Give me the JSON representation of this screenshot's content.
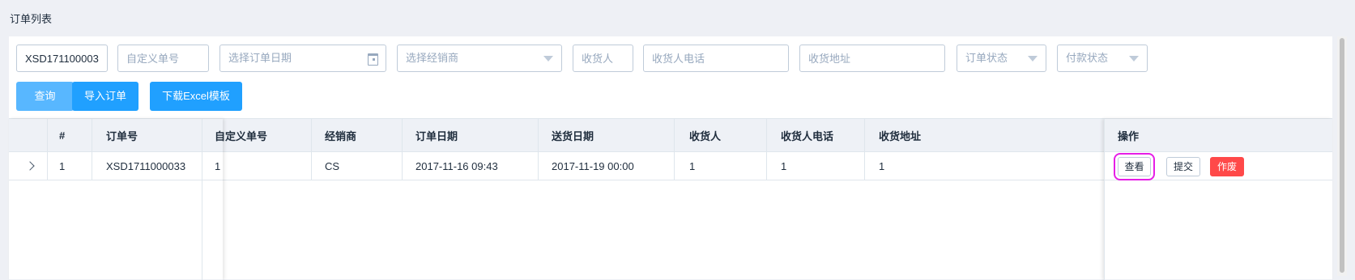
{
  "page": {
    "title": "订单列表"
  },
  "filters": {
    "order_no_value": "XSD171100003",
    "custom_no_placeholder": "自定义单号",
    "date_placeholder": "选择订单日期",
    "dealer_placeholder": "选择经销商",
    "receiver_placeholder": "收货人",
    "receiver_phone_placeholder": "收货人电话",
    "address_placeholder": "收货地址",
    "order_status_placeholder": "订单状态",
    "payment_status_placeholder": "付款状态"
  },
  "actions": {
    "query_label": "查询",
    "import_label": "导入订单",
    "download_label": "下载Excel模板"
  },
  "table": {
    "headers": [
      "",
      "#",
      "订单号",
      "自定义单号",
      "经销商",
      "订单日期",
      "送货日期",
      "收货人",
      "收货人电话",
      "收货地址",
      "操作"
    ],
    "rows": [
      {
        "index": "1",
        "order_no": "XSD1711000033",
        "custom_no": "1",
        "dealer": "CS",
        "order_date": "2017-11-16 09:43",
        "delivery_date": "2017-11-19 00:00",
        "receiver": "1",
        "receiver_phone": "1",
        "address": "1"
      }
    ],
    "row_actions": {
      "view": "查看",
      "submit": "提交",
      "void": "作废"
    }
  },
  "colors": {
    "primary": "#20a0ff",
    "danger": "#ff4949",
    "highlight": "#e61ee6"
  }
}
